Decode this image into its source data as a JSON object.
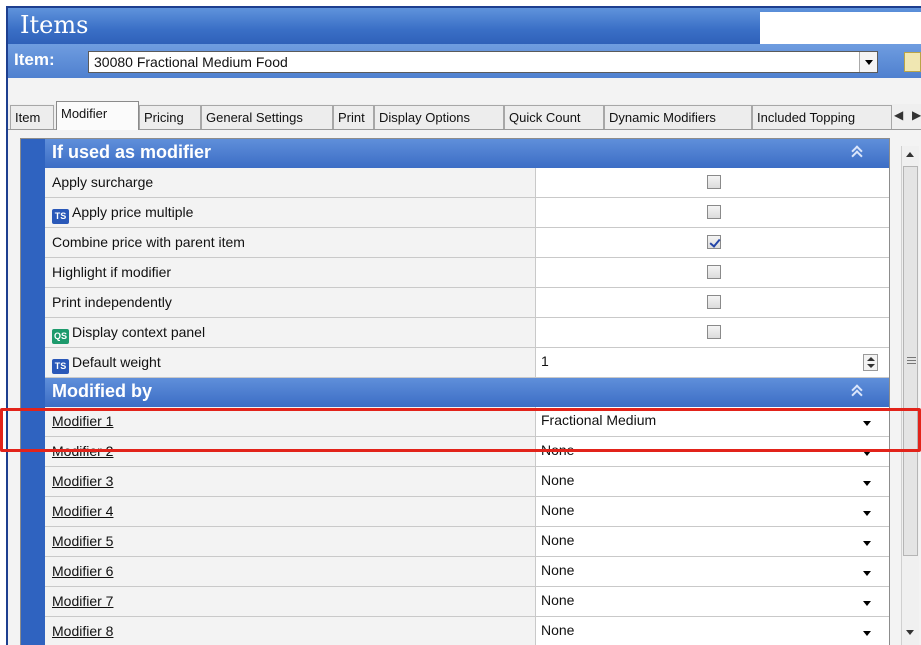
{
  "window": {
    "title": "Items"
  },
  "item_selector": {
    "label": "Item:",
    "value": "30080 Fractional  Medium Food"
  },
  "tabs": [
    {
      "label": "Item"
    },
    {
      "label": "Modifier"
    },
    {
      "label": "Pricing"
    },
    {
      "label": "General Settings"
    },
    {
      "label": "Print"
    },
    {
      "label": "Display Options"
    },
    {
      "label": "Quick Count"
    },
    {
      "label": "Dynamic Modifiers"
    },
    {
      "label": "Included Topping"
    }
  ],
  "active_tab": "Modifier",
  "icons": {
    "ts_badge": "TS",
    "qs_badge": "QS"
  },
  "sections": {
    "if_used": {
      "title": "If used as modifier",
      "rows": [
        {
          "label": "Apply surcharge",
          "type": "checkbox",
          "checked": false
        },
        {
          "label": "Apply price multiple",
          "type": "checkbox",
          "checked": false,
          "badge": "ts-icon"
        },
        {
          "label": "Combine price with parent item",
          "type": "checkbox",
          "checked": true
        },
        {
          "label": "Highlight if modifier",
          "type": "checkbox",
          "checked": false
        },
        {
          "label": "Print independently",
          "type": "checkbox",
          "checked": false
        },
        {
          "label": "Display context panel",
          "type": "checkbox",
          "checked": false,
          "badge": "qs-icon"
        },
        {
          "label": "Default weight",
          "type": "number",
          "value": "1",
          "badge": "ts-icon"
        }
      ]
    },
    "modified_by": {
      "title": "Modified by",
      "rows": [
        {
          "label": "Modifier 1",
          "value": "Fractional Medium"
        },
        {
          "label": "Modifier 2",
          "value": "None"
        },
        {
          "label": "Modifier 3",
          "value": "None"
        },
        {
          "label": "Modifier 4",
          "value": "None"
        },
        {
          "label": "Modifier 5",
          "value": "None"
        },
        {
          "label": "Modifier 6",
          "value": "None"
        },
        {
          "label": "Modifier 7",
          "value": "None"
        },
        {
          "label": "Modifier 8",
          "value": "None"
        }
      ]
    }
  },
  "colors": {
    "accent": "#3c6dc5",
    "highlight": "#e2231a",
    "title_bar": "#3a6fc6"
  }
}
